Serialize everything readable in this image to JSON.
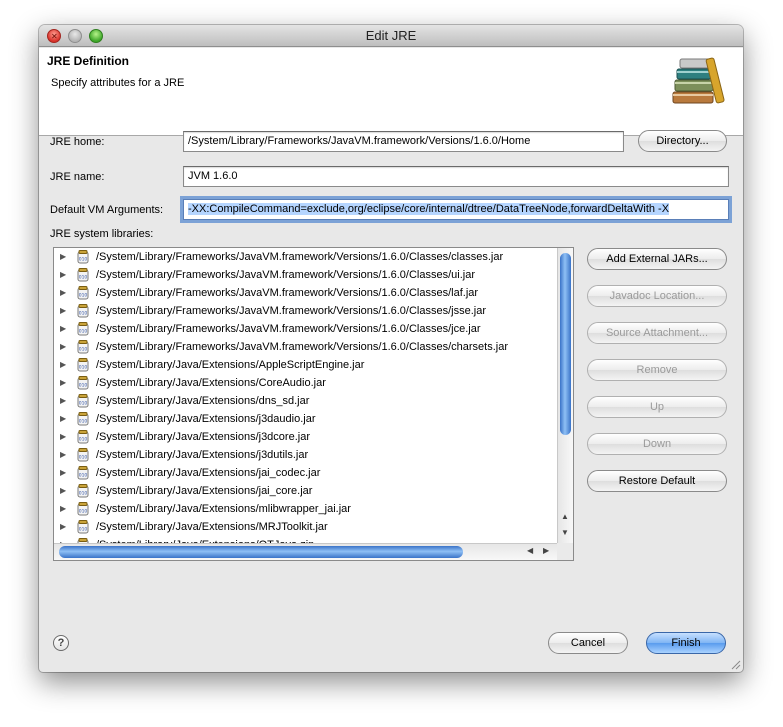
{
  "window": {
    "title": "Edit JRE"
  },
  "header": {
    "title": "JRE Definition",
    "subtitle": "Specify attributes for a JRE"
  },
  "fields": {
    "jre_home_label": "JRE home:",
    "jre_home_value": "/System/Library/Frameworks/JavaVM.framework/Versions/1.6.0/Home",
    "directory_button": "Directory...",
    "jre_name_label": "JRE name:",
    "jre_name_value": "JVM 1.6.0",
    "vm_args_label": "Default VM Arguments:",
    "vm_args_value": "-XX:CompileCommand=exclude,org/eclipse/core/internal/dtree/DataTreeNode,forwardDeltaWith -X"
  },
  "libraries": {
    "label": "JRE system libraries:",
    "items": [
      "/System/Library/Frameworks/JavaVM.framework/Versions/1.6.0/Classes/classes.jar",
      "/System/Library/Frameworks/JavaVM.framework/Versions/1.6.0/Classes/ui.jar",
      "/System/Library/Frameworks/JavaVM.framework/Versions/1.6.0/Classes/laf.jar",
      "/System/Library/Frameworks/JavaVM.framework/Versions/1.6.0/Classes/jsse.jar",
      "/System/Library/Frameworks/JavaVM.framework/Versions/1.6.0/Classes/jce.jar",
      "/System/Library/Frameworks/JavaVM.framework/Versions/1.6.0/Classes/charsets.jar",
      "/System/Library/Java/Extensions/AppleScriptEngine.jar",
      "/System/Library/Java/Extensions/CoreAudio.jar",
      "/System/Library/Java/Extensions/dns_sd.jar",
      "/System/Library/Java/Extensions/j3daudio.jar",
      "/System/Library/Java/Extensions/j3dcore.jar",
      "/System/Library/Java/Extensions/j3dutils.jar",
      "/System/Library/Java/Extensions/jai_codec.jar",
      "/System/Library/Java/Extensions/jai_core.jar",
      "/System/Library/Java/Extensions/mlibwrapper_jai.jar",
      "/System/Library/Java/Extensions/MRJToolkit.jar",
      "/System/Library/Java/Extensions/QTJava.zip"
    ]
  },
  "side_buttons": {
    "add_external_jars": "Add External JARs...",
    "javadoc_location": "Javadoc Location...",
    "source_attachment": "Source Attachment...",
    "remove": "Remove",
    "up": "Up",
    "down": "Down",
    "restore_default": "Restore Default"
  },
  "footer": {
    "help": "?",
    "cancel": "Cancel",
    "finish": "Finish"
  },
  "icons": {
    "library": "books-icon",
    "jar": "jar-icon",
    "expand": "triangle-right-icon"
  }
}
